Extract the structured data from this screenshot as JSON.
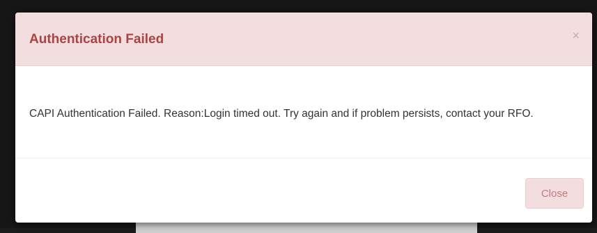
{
  "dialog": {
    "title": "Authentication Failed",
    "close_icon_glyph": "×",
    "message": "CAPI Authentication Failed. Reason:Login timed out. Try again and if problem persists, contact your RFO.",
    "close_button_label": "Close"
  },
  "colors": {
    "header_background": "#f2dede",
    "title_text": "#a94442",
    "button_text": "#c07a7a"
  },
  "icons": {
    "header_close": "close-icon"
  }
}
